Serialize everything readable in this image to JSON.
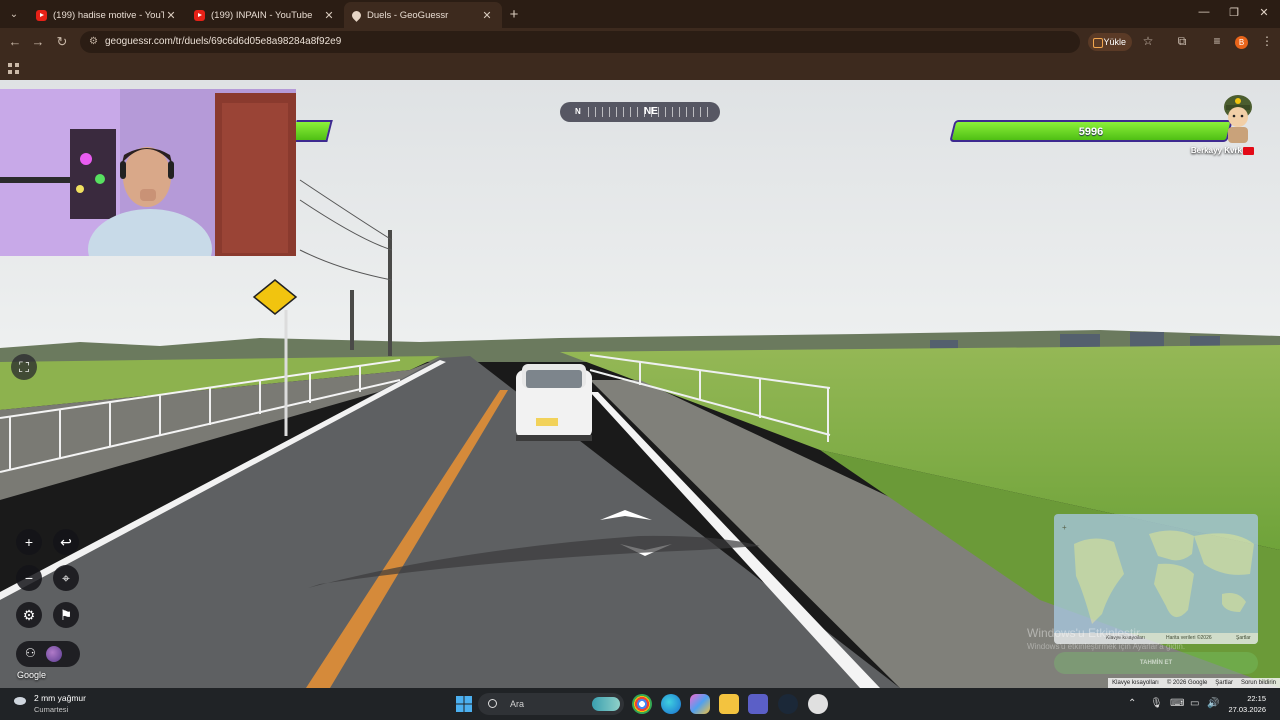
{
  "browser": {
    "tabs": [
      {
        "title": "(199) hadise motive - YouTube",
        "icon": "youtube-icon",
        "active": false
      },
      {
        "title": "(199) INPAIN - YouTube",
        "icon": "youtube-icon",
        "active": false
      },
      {
        "title": "Duels - GeoGuessr",
        "icon": "geoguessr-pin-icon",
        "active": true
      }
    ],
    "url": "geoguessr.com/tr/duels/69c6d6d05e8a98284a8f92e9",
    "install_label": "Yükle",
    "profile_initial": "B"
  },
  "game": {
    "compass": {
      "north": "N",
      "heading": "NE"
    },
    "player": {
      "health": "5996",
      "name": "Berkayy Kvrk"
    },
    "google_label": "Google",
    "minimap": {
      "footer_items": [
        "Klavye kısayolları",
        "Harita verileri ©2026",
        "Şartlar"
      ],
      "guess_label": "TAHMİN ET"
    },
    "watermark": {
      "title": "Windows'u Etkinleştir",
      "subtitle": "Windows'u etkinleştirmek için Ayarlar'a gidin."
    },
    "attribution": [
      "Klavye kısayolları",
      "© 2026 Google",
      "Şartlar",
      "Sorun bildirin"
    ]
  },
  "taskbar": {
    "weather": {
      "temp": "2 mm yağmur",
      "day": "Cumartesi"
    },
    "search_placeholder": "Ara",
    "time": "22:15",
    "date": "27.03.2026"
  },
  "colors": {
    "health_green": "#6cd620",
    "health_border": "#3e2a90",
    "browser_bg": "#3d2a1e",
    "taskbar_bg": "#202326"
  }
}
